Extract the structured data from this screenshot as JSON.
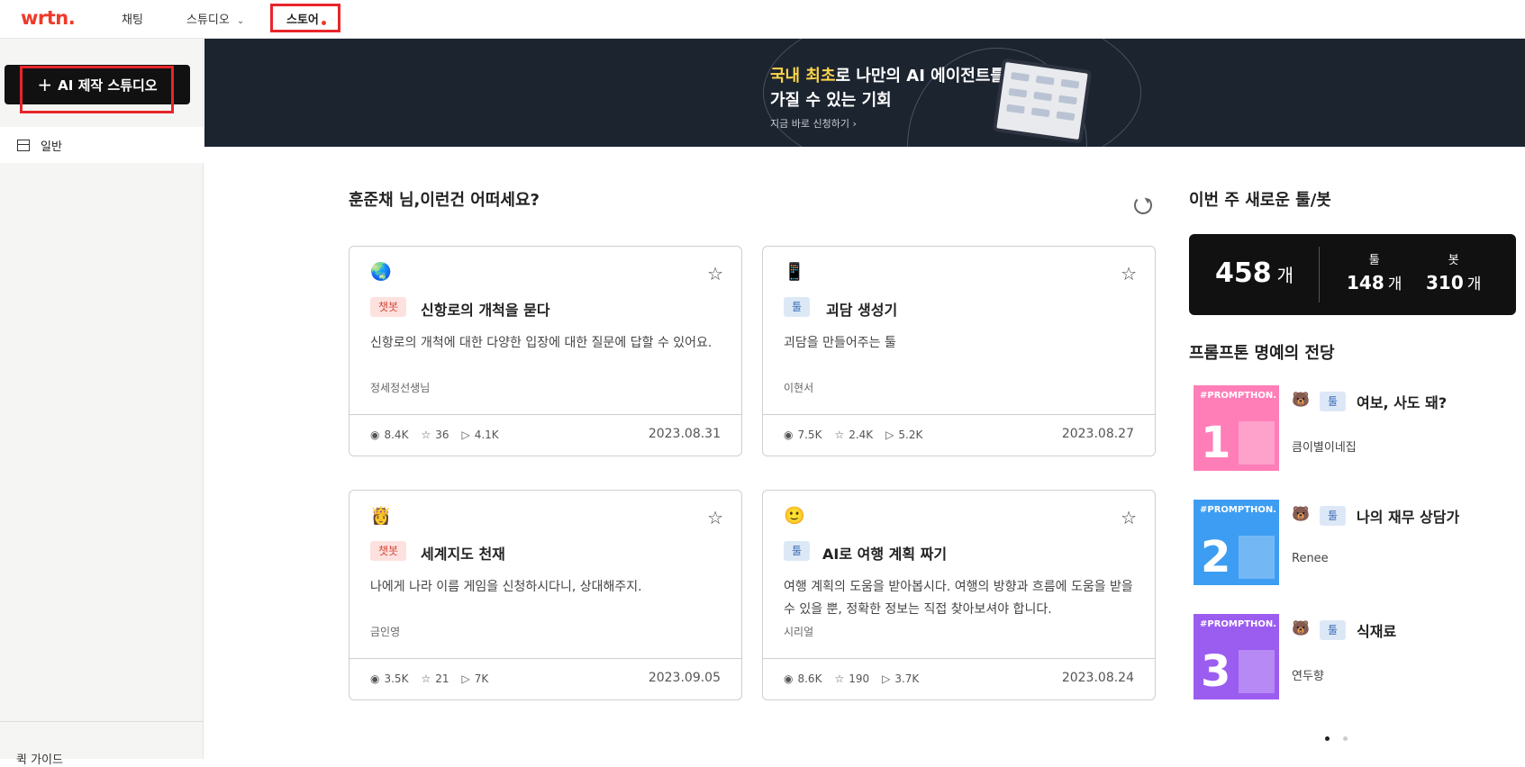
{
  "topnav": {
    "logo": "wrtn.",
    "items": [
      "채팅",
      "스튜디오",
      "스토어"
    ]
  },
  "sidebar": {
    "create_button": "AI 제작 스튜디오",
    "general_label": "일반",
    "guide_label": "퀵 가이드"
  },
  "banner": {
    "line1_highlight": "국내 최초",
    "line1_rest": "로 나만의 AI 에이전트를",
    "line2": "가질 수 있는 기회",
    "cta": "지금 바로 신청하기 ›"
  },
  "recommend": {
    "title": "훈준채 님,이런건 어떠세요?",
    "cards": [
      {
        "emoji": "🌏",
        "tag": "챗봇",
        "title": "신항로의 개척을 묻다",
        "desc": "신항로의 개척에 대한 다양한 입장에 대한 질문에 답할 수 있어요.",
        "author": "정세정선생님",
        "views": "8.4K",
        "stars": "36",
        "plays": "4.1K",
        "date": "2023.08.31"
      },
      {
        "emoji": "📱",
        "tag": "툴",
        "title": "괴담 생성기",
        "desc": "괴담을 만들어주는 툴",
        "author": "이현서",
        "views": "7.5K",
        "stars": "2.4K",
        "plays": "5.2K",
        "date": "2023.08.27"
      },
      {
        "emoji": "👸",
        "tag": "챗봇",
        "title": "세계지도 천재",
        "desc": "나에게 나라 이름 게임을 신청하시다니, 상대해주지.",
        "author": "금인영",
        "views": "3.5K",
        "stars": "21",
        "plays": "7K",
        "date": "2023.09.05"
      },
      {
        "emoji": "🙂",
        "tag": "툴",
        "title": "AI로 여행 계획 짜기",
        "desc": "여행 계획의 도움을 받아봅시다. 여행의 방향과 흐름에 도움을 받을 수 있을 뿐, 정확한 정보는 직접 찾아보셔야 합니다.",
        "author": "시리얼",
        "views": "8.6K",
        "stars": "190",
        "plays": "3.7K",
        "date": "2023.08.24"
      }
    ]
  },
  "weekly": {
    "title": "이번 주 새로운 툴/봇",
    "total": "458",
    "unit": "개",
    "tool_label": "툴",
    "tool_count": "148",
    "bot_label": "봇",
    "bot_count": "310"
  },
  "hall_of_fame": {
    "title": "프롬프톤 명예의 전당",
    "brand": "#PROMPTHON.",
    "items": [
      {
        "rank": "1",
        "emoji": "🐻",
        "tag": "툴",
        "name": "여보, 사도 돼?",
        "author": "큼이별이네집",
        "color": "#ff7eb8"
      },
      {
        "rank": "2",
        "emoji": "🐻",
        "tag": "툴",
        "name": "나의 재무 상담가",
        "author": "Renee",
        "color": "#3d9df2"
      },
      {
        "rank": "3",
        "emoji": "🐻",
        "tag": "툴",
        "name": "식재료",
        "author": "연두향",
        "color": "#9b5cf0"
      }
    ]
  },
  "colors": {
    "brand": "#ef3a2a",
    "highlight_box": "#e8252a",
    "banner_bg": "#1c2430",
    "banner_highlight": "#ffd54a"
  }
}
